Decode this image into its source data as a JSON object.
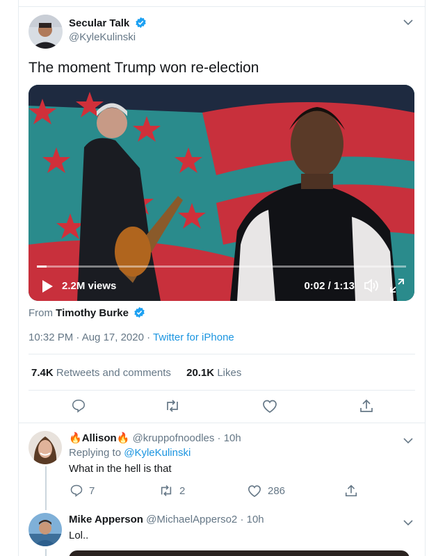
{
  "tweet": {
    "author": {
      "name": "Secular Talk",
      "handle": "@KyleKulinski"
    },
    "text": "The moment Trump won re-election",
    "video": {
      "views": "2.2M views",
      "time": "0:02 / 1:13",
      "progress": 0.027
    },
    "from": {
      "label": "From",
      "name": "Timothy Burke"
    },
    "timestamp": "10:32 PM · Aug 17, 2020",
    "separator": "·",
    "client": "Twitter for iPhone",
    "stats": {
      "retweets_count": "7.4K",
      "retweets_label": "Retweets and comments",
      "likes_count": "20.1K",
      "likes_label": "Likes"
    }
  },
  "replies": [
    {
      "name": "Allison",
      "handle": "@kruppofnoodles",
      "time": "· 10h",
      "replying_label": "Replying to",
      "replying_to": "@KyleKulinski",
      "text": "What in the hell is that",
      "reply_count": "7",
      "retweet_count": "2",
      "like_count": "286"
    },
    {
      "name": "Mike Apperson",
      "handle": "@MichaelApperso2",
      "time": "· 10h",
      "text": "Lol.."
    }
  ],
  "colors": {
    "accent": "#1b95e0",
    "verified": "#1da1f2",
    "muted": "#657786",
    "border": "#e6ecf0"
  },
  "icons": [
    "verified-badge-icon",
    "chevron-down-icon",
    "play-icon",
    "volume-icon",
    "fullscreen-icon",
    "reply-icon",
    "retweet-icon",
    "like-icon",
    "share-icon",
    "fire-emoji-icon"
  ]
}
